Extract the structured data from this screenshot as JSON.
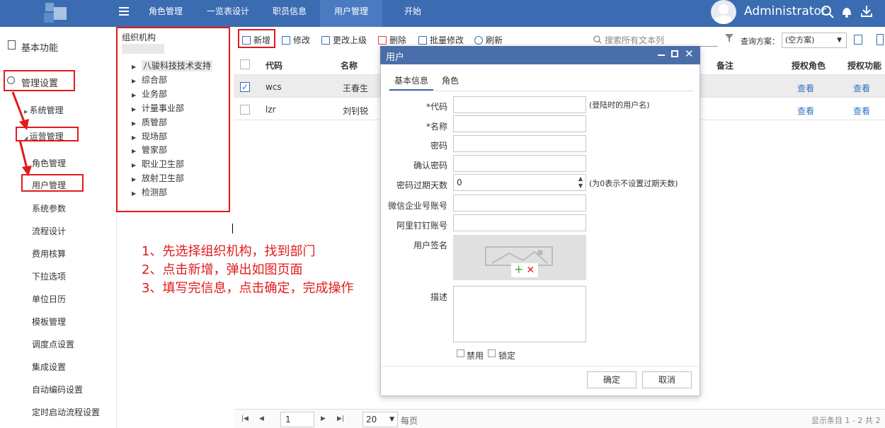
{
  "top_nav": {
    "tabs": [
      {
        "label": "角色管理"
      },
      {
        "label": "一览表设计"
      },
      {
        "label": "职员信息"
      },
      {
        "label": "用户管理"
      },
      {
        "label": "开始"
      }
    ],
    "user_name": "Administrator"
  },
  "sidebar": {
    "basic": "基本功能",
    "mgmt": "管理设置",
    "system_mgmt": "系统管理",
    "ops_mgmt": "运营管理",
    "items": [
      "角色管理",
      "用户管理",
      "系统参数",
      "流程设计",
      "费用核算",
      "下拉选项",
      "单位日历",
      "模板管理",
      "调度点设置",
      "集成设置",
      "自动编码设置",
      "定时启动流程设置"
    ]
  },
  "org": {
    "title": "组织机构",
    "items": [
      "八骏科技技术支持",
      "综合部",
      "业务部",
      "计量事业部",
      "质管部",
      "现场部",
      "管家部",
      "职业卫生部",
      "放射卫生部",
      "检测部"
    ]
  },
  "toolbar": {
    "add": "新增",
    "edit": "修改",
    "change_parent": "更改上级",
    "delete": "删除",
    "batch_edit": "批量修改",
    "refresh": "刷新",
    "search_placeholder": "搜索所有文本列",
    "query_label": "查询方案：",
    "query_value": "(空方案)"
  },
  "grid": {
    "headers": {
      "code": "代码",
      "name": "名称",
      "remark": "备注",
      "auth_role": "授权角色",
      "auth_func": "授权功能"
    },
    "rows": [
      {
        "code": "wcs",
        "name": "王春生",
        "view1": "查看",
        "view2": "查看"
      },
      {
        "code": "lzr",
        "name": "刘钊锐",
        "view1": "查看",
        "view2": "查看"
      }
    ]
  },
  "pager": {
    "page": "1",
    "page_size": "20",
    "per_page": "每页",
    "summary": "显示条目 1 - 2 共 2"
  },
  "dialog": {
    "title": "用户",
    "tabs": [
      "基本信息",
      "角色"
    ],
    "fields": {
      "code": "*代码",
      "name": "*名称",
      "password": "密码",
      "confirm": "确认密码",
      "expire": "密码过期天数",
      "wechat": "微信企业号账号",
      "dingtalk": "阿里钉钉账号",
      "sign": "用户签名",
      "desc": "描述"
    },
    "expire_value": "0",
    "hint_login": "(登陆时的用户名)",
    "hint_expire": "(为0表示不设置过期天数)",
    "disable": "禁用",
    "lock": "锁定",
    "ok": "确定",
    "cancel": "取消"
  },
  "instructions": {
    "line1": "1、先选择组织机构，找到部门",
    "line2": "2、点击新增，弹出如图页面",
    "line3": "3、填写完信息，点击确定，完成操作"
  },
  "colors": {
    "topbar": "#3b6cb2",
    "annotation": "#e21b1b",
    "link": "#2f73c4"
  }
}
